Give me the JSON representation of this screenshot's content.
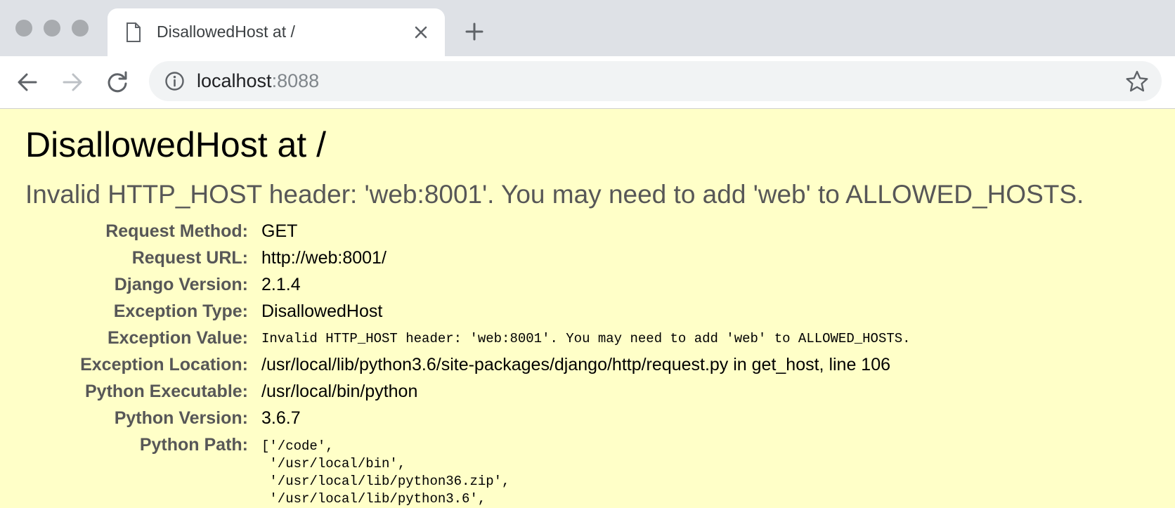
{
  "browser": {
    "tab_title": "DisallowedHost at /",
    "url_host": "localhost",
    "url_port": ":8088"
  },
  "page": {
    "title": "DisallowedHost at /",
    "subtitle": "Invalid HTTP_HOST header: 'web:8001'. You may need to add 'web' to ALLOWED_HOSTS."
  },
  "meta": [
    {
      "label": "Request Method:",
      "value": "GET"
    },
    {
      "label": "Request URL:",
      "value": "http://web:8001/"
    },
    {
      "label": "Django Version:",
      "value": "2.1.4"
    },
    {
      "label": "Exception Type:",
      "value": "DisallowedHost"
    },
    {
      "label": "Exception Value:",
      "value": "Invalid HTTP_HOST header: 'web:8001'. You may need to add 'web' to ALLOWED_HOSTS."
    },
    {
      "label": "Exception Location:",
      "value": "/usr/local/lib/python3.6/site-packages/django/http/request.py in get_host, line 106"
    },
    {
      "label": "Python Executable:",
      "value": "/usr/local/bin/python"
    },
    {
      "label": "Python Version:",
      "value": "3.6.7"
    },
    {
      "label": "Python Path:",
      "value": ""
    }
  ],
  "python_path": [
    "['/code',",
    " '/usr/local/bin',",
    " '/usr/local/lib/python36.zip',",
    " '/usr/local/lib/python3.6',"
  ],
  "colors": {
    "page_background": "#ffffc8",
    "tabstrip": "#dee1e6",
    "label": "#575757"
  }
}
